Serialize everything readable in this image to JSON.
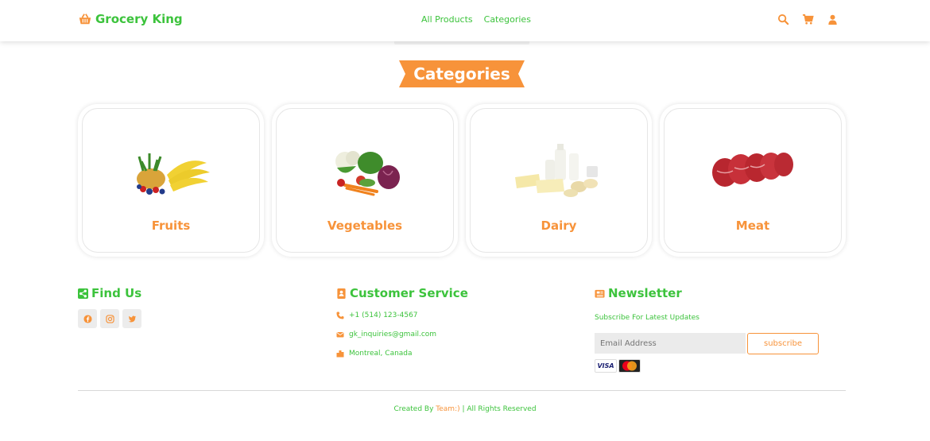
{
  "brand": {
    "name": "Grocery King",
    "icon": "basket-icon",
    "color": "#3cc33c",
    "accent": "#f7933a"
  },
  "nav": {
    "links": [
      "All Products",
      "Categories"
    ]
  },
  "header_icons": [
    "search-icon",
    "cart-icon",
    "user-icon"
  ],
  "banner": {
    "title": "Categories"
  },
  "categories": [
    {
      "label": "Fruits",
      "image": "fruits-image"
    },
    {
      "label": "Vegetables",
      "image": "vegetables-image"
    },
    {
      "label": "Dairy",
      "image": "dairy-image"
    },
    {
      "label": "Meat",
      "image": "meat-image"
    }
  ],
  "footer": {
    "find_us": {
      "title": "Find Us",
      "icon": "share-icon",
      "social": [
        "facebook-icon",
        "instagram-icon",
        "twitter-icon"
      ]
    },
    "customer_service": {
      "title": "Customer Service",
      "icon": "contact-book-icon",
      "phone": "+1 (514) 123-4567",
      "email": "gk_inquiries@gmail.com",
      "location": "Montreal, Canada"
    },
    "newsletter": {
      "title": "Newsletter",
      "icon": "newspaper-icon",
      "subtitle": "Subscribe For Latest Updates",
      "input_placeholder": "Email Address",
      "button_label": "subscribe",
      "payment_cards": [
        "VISA",
        "MasterCard"
      ]
    },
    "copyright": {
      "prefix": "Created By ",
      "team": "Team:)",
      "suffix": " | All Rights Reserved"
    }
  }
}
